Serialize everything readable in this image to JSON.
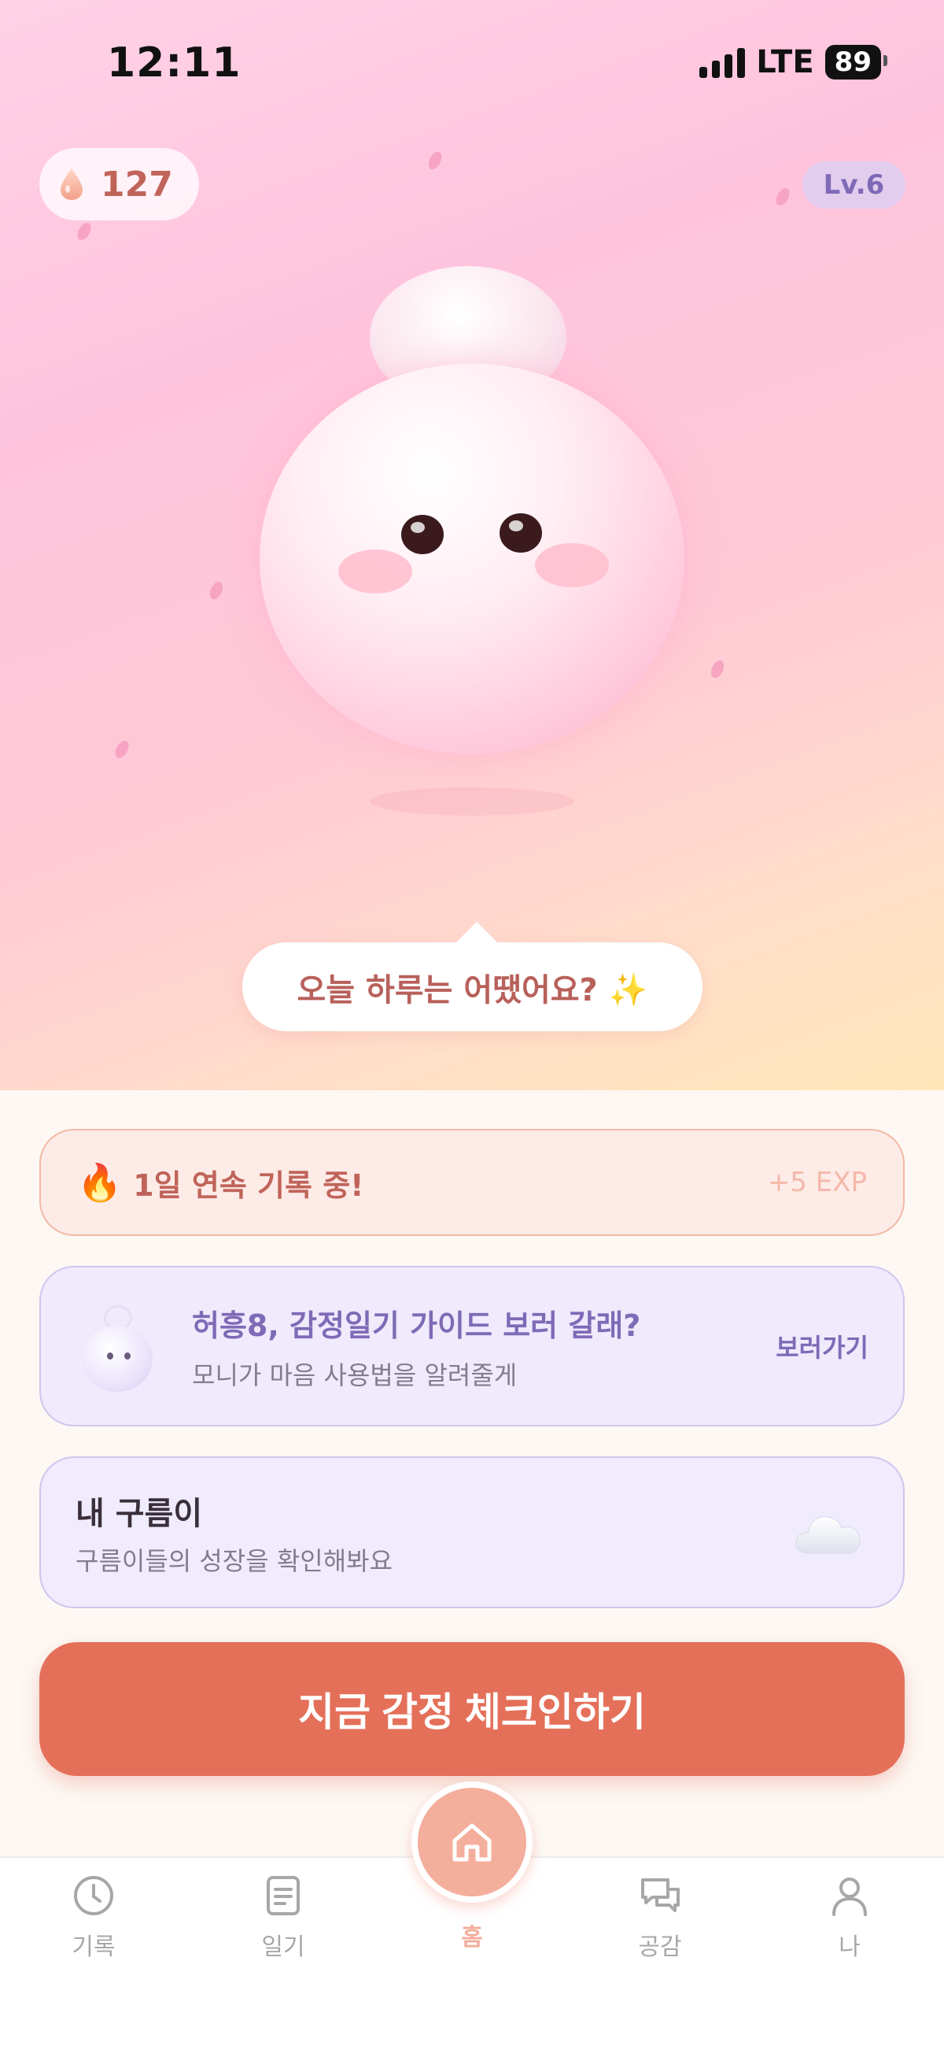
{
  "status_bar": {
    "time": "12:11",
    "network": "LTE",
    "battery": "89"
  },
  "header": {
    "drop_count": "127",
    "level": "Lv.6"
  },
  "speech_bubble": {
    "text": "오늘 하루는 어땠어요? ✨"
  },
  "streak_card": {
    "icon": "🔥",
    "text": "1일 연속 기록 중!",
    "exp": "+5 EXP"
  },
  "guide_card": {
    "title": "허흥8, 감정일기 가이드 보러 갈래?",
    "subtitle": "모니가 마음 사용법을 알려줄게",
    "link": "보러가기"
  },
  "cloud_card": {
    "title": "내 구름이",
    "subtitle": "구름이들의 성장을 확인해봐요",
    "icon": "cloud-icon"
  },
  "cta": {
    "label": "지금 감정 체크인하기"
  },
  "tabbar": {
    "tabs": [
      {
        "label": "기록",
        "icon": "clock-icon"
      },
      {
        "label": "일기",
        "icon": "document-icon"
      },
      {
        "label": "홈",
        "icon": "home-icon",
        "active": true
      },
      {
        "label": "공감",
        "icon": "chat-bubbles-icon"
      },
      {
        "label": "나",
        "icon": "person-icon"
      }
    ]
  },
  "colors": {
    "accent": "#e5705a",
    "purple": "#7e6ab6",
    "active_tab": "#f4ae9c"
  }
}
